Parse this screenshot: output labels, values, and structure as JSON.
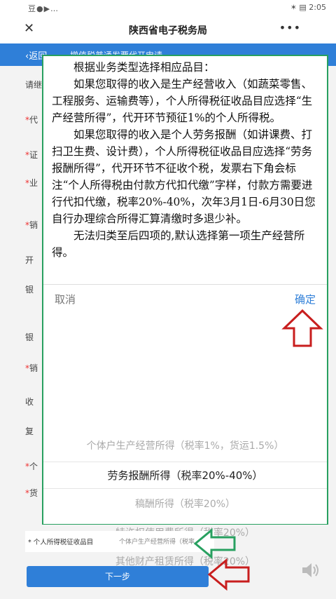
{
  "statusbar": {
    "left": "豆●▶…",
    "right": "✶ ▤ 2:05"
  },
  "titlebar": {
    "close": "✕",
    "title": "陕西省电子税务局",
    "more": "•••"
  },
  "navbar": {
    "back": "‹返回",
    "title": "增值税普通发票代开申请"
  },
  "left_strip": [
    {
      "req": "",
      "text": "请继"
    },
    {
      "req": "*",
      "text": "代"
    },
    {
      "req": "*",
      "text": "证"
    },
    {
      "req": "*",
      "text": "业"
    },
    {
      "req": "*",
      "text": "销"
    },
    {
      "req": "",
      "text": "开"
    },
    {
      "req": "",
      "text": "银"
    },
    {
      "req": "",
      "text": "银"
    },
    {
      "req": "*",
      "text": "销"
    },
    {
      "req": "",
      "text": "收"
    },
    {
      "req": "",
      "text": "复"
    },
    {
      "req": "*",
      "text": "个"
    },
    {
      "req": "*",
      "text": "货"
    }
  ],
  "note": {
    "p1": "根据业务类型选择相应品目：",
    "p2": "如果您取得的收入是生产经营收入（如蔬菜零售、工程服务、运输费等），个人所得税征收品目应选择“生产经营所得”，代开环节预征1%的个人所得税。",
    "p3": "如果您取得的收入是个人劳务报酬（如讲课费、打扫卫生费、设计费），个人所得税征收品目应选择“劳务报酬所得”，代开环节不征收个税，发票右下角会标注“个人所得税由付款方代扣代缴”字样，付款方需要进行代扣代缴，税率20%-40%，次年3月1日-6月30日您自行办理综合所得汇算清缴时多退少补。",
    "p4": "无法归类至后四项的,默认选择第一项生产经营所得。"
  },
  "picker": {
    "cancel": "取消",
    "confirm": "确定",
    "options": [
      "个体户生产经营所得（税率1%，货运1.5%）",
      "劳务报酬所得（税率20%-40%）",
      "稿酬所得（税率20%）",
      "特许权使用费所得（税率20%）",
      "其他财产租赁所得（税率20%）"
    ],
    "selected_index": 1
  },
  "form_row": {
    "label": "* 个人所得税征收品目",
    "value": "个体户生产经营所得（税率"
  },
  "next_button": "下一步",
  "colors": {
    "accent": "#2f7fd8",
    "annotation_box": "#28a060",
    "arrow_red": "#c81e1e",
    "arrow_green": "#28a060"
  }
}
